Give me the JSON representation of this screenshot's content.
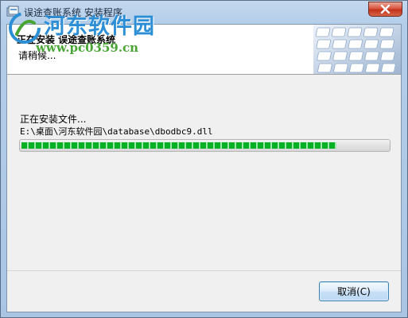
{
  "window": {
    "title": "误途查账系统 安装程序"
  },
  "watermark": {
    "title": "河东软件园",
    "url": "www.pc0359.cn"
  },
  "header": {
    "title": "正在安装 误途查账系统",
    "subtitle": "请稍候..."
  },
  "body": {
    "status_text": "正在安装文件...",
    "current_file": "E:\\桌面\\河东软件园\\database\\dbodbc9.dll",
    "progress_fraction": 0.86
  },
  "buttons": {
    "cancel_label": "取消(C)"
  },
  "colors": {
    "progress": "#06b025",
    "watermark_title": "#2c8fd6",
    "watermark_url": "#49a635"
  },
  "icons": [
    "installer-icon",
    "close-icon",
    "watermark-logo",
    "keyboard-image"
  ]
}
